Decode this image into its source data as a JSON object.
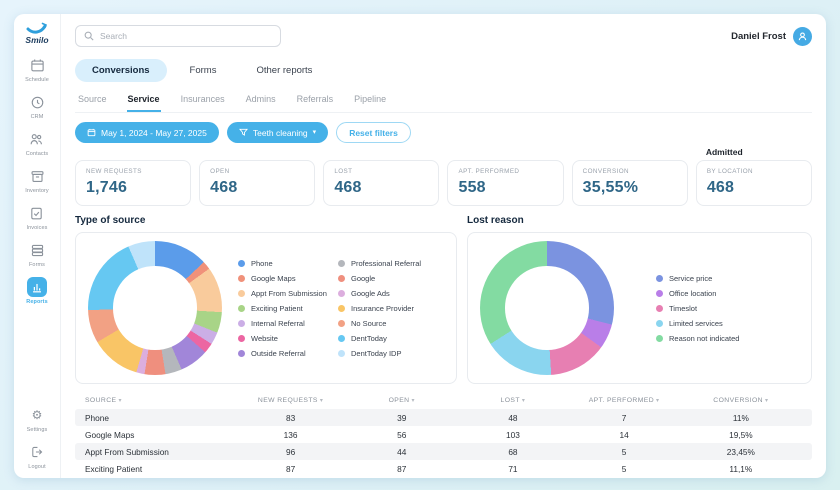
{
  "sidebar": {
    "logo_text": "Smilo",
    "items": [
      {
        "label": "Schedule",
        "icon": "calendar-icon",
        "active": false
      },
      {
        "label": "CRM",
        "icon": "crm-icon",
        "active": false
      },
      {
        "label": "Contacts",
        "icon": "contacts-icon",
        "active": false
      },
      {
        "label": "Inventory",
        "icon": "inventory-icon",
        "active": false
      },
      {
        "label": "Invoices",
        "icon": "invoices-icon",
        "active": false
      },
      {
        "label": "Forms",
        "icon": "forms-icon",
        "active": false
      },
      {
        "label": "Reports",
        "icon": "bar-chart-icon",
        "active": true
      }
    ],
    "footer_items": [
      {
        "label": "Settings",
        "icon": "gear-icon"
      },
      {
        "label": "Logout",
        "icon": "logout-icon"
      }
    ]
  },
  "header": {
    "search_placeholder": "Search",
    "user_name": "Daniel Frost"
  },
  "tabs": [
    {
      "label": "Conversions",
      "active": true
    },
    {
      "label": "Forms",
      "active": false
    },
    {
      "label": "Other reports",
      "active": false
    }
  ],
  "subtabs": [
    {
      "label": "Source",
      "active": false
    },
    {
      "label": "Service",
      "active": true
    },
    {
      "label": "Insurances",
      "active": false
    },
    {
      "label": "Admins",
      "active": false
    },
    {
      "label": "Referrals",
      "active": false
    },
    {
      "label": "Pipeline",
      "active": false
    }
  ],
  "filters": {
    "date_range": "May 1, 2024 - May 27, 2025",
    "service_filter": "Teeth cleaning",
    "reset_label": "Reset filters"
  },
  "kpi_section": {
    "admitted_label": "Admitted",
    "cards": [
      {
        "label": "NEW REQUESTS",
        "value": "1,746"
      },
      {
        "label": "OPEN",
        "value": "468"
      },
      {
        "label": "LOST",
        "value": "468"
      },
      {
        "label": "APT. PERFORMED",
        "value": "558"
      },
      {
        "label": "CONVERSION",
        "value": "35,55%"
      },
      {
        "label": "BY LOCATION",
        "value": "468"
      }
    ]
  },
  "chart_data": [
    {
      "type": "pie",
      "variant": "donut",
      "title": "Type of source",
      "legend_position": "right",
      "unit": "percent",
      "series": [
        {
          "name": "Phone",
          "value": 13,
          "color": "#5b9cea"
        },
        {
          "name": "Google Maps",
          "value": 2,
          "color": "#f0917a"
        },
        {
          "name": "Appt From Submission",
          "value": 11,
          "color": "#f9cb9c"
        },
        {
          "name": "Exciting Patient",
          "value": 5,
          "color": "#a8d487"
        },
        {
          "name": "Internal Referral",
          "value": 3,
          "color": "#cbaee6"
        },
        {
          "name": "Website",
          "value": 2.5,
          "color": "#ec66a2"
        },
        {
          "name": "Outside Referral",
          "value": 7,
          "color": "#a186d9"
        },
        {
          "name": "Professional Referral",
          "value": 4,
          "color": "#b4b7bc"
        },
        {
          "name": "Google",
          "value": 5,
          "color": "#ef8f7e"
        },
        {
          "name": "Google Ads",
          "value": 2,
          "color": "#dcaede"
        },
        {
          "name": "Insurance Provider",
          "value": 12,
          "color": "#f9c566"
        },
        {
          "name": "No Source",
          "value": 8,
          "color": "#f2a184"
        },
        {
          "name": "DentToday",
          "value": 19,
          "color": "#66c8f2"
        },
        {
          "name": "DentToday IDP",
          "value": 6.5,
          "color": "#bfe3fa"
        }
      ]
    },
    {
      "type": "pie",
      "variant": "donut",
      "title": "Lost reason",
      "legend_position": "right",
      "unit": "percent",
      "series": [
        {
          "name": "Service price",
          "value": 29,
          "color": "#7b93e0"
        },
        {
          "name": "Office location",
          "value": 6,
          "color": "#b97ee8"
        },
        {
          "name": "Timeslot",
          "value": 14,
          "color": "#e77fb2"
        },
        {
          "name": "Limited services",
          "value": 17,
          "color": "#8ad5ef"
        },
        {
          "name": "Reason not indicated",
          "value": 34,
          "color": "#83dba2"
        }
      ]
    }
  ],
  "table": {
    "columns": [
      "SOURCE",
      "NEW REQUESTS",
      "OPEN",
      "LOST",
      "APT. PERFORMED",
      "CONVERSION"
    ],
    "rows": [
      [
        "Phone",
        "83",
        "39",
        "48",
        "7",
        "11%"
      ],
      [
        "Google Maps",
        "136",
        "56",
        "103",
        "14",
        "19,5%"
      ],
      [
        "Appt From Submission",
        "96",
        "44",
        "68",
        "5",
        "23,45%"
      ],
      [
        "Exciting Patient",
        "87",
        "87",
        "71",
        "5",
        "11,1%"
      ]
    ]
  }
}
